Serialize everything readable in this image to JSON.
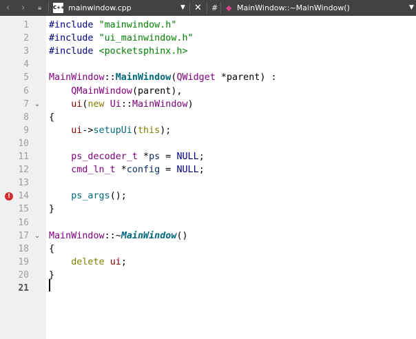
{
  "toolbar": {
    "back_icon": "chevron-left-icon",
    "forward_icon": "chevron-right-icon",
    "lock_icon": "lock-icon",
    "file_badge": "C++",
    "file_name": "mainwindow.cpp",
    "dropdown_icon": "caret-down-icon",
    "close_icon": "close-icon",
    "hash_label": "#",
    "symbol_icon": "method-icon",
    "symbol_name": "MainWindow::~MainWindow()",
    "symbol_dropdown_icon": "caret-down-icon"
  },
  "editor": {
    "current_line": "21",
    "error_line": "14",
    "lines": [
      {
        "num": "1",
        "tokens": [
          {
            "t": "#include ",
            "c": "pre"
          },
          {
            "t": "\"mainwindow.h\"",
            "c": "str"
          }
        ]
      },
      {
        "num": "2",
        "tokens": [
          {
            "t": "#include ",
            "c": "pre"
          },
          {
            "t": "\"ui_mainwindow.h\"",
            "c": "str"
          }
        ]
      },
      {
        "num": "3",
        "tokens": [
          {
            "t": "#include ",
            "c": "pre"
          },
          {
            "t": "<pocketsphinx.h>",
            "c": "str"
          }
        ]
      },
      {
        "num": "4",
        "tokens": []
      },
      {
        "num": "5",
        "tokens": [
          {
            "t": "MainWindow",
            "c": "type"
          },
          {
            "t": "::",
            "c": "plain"
          },
          {
            "t": "MainWindow",
            "c": "func"
          },
          {
            "t": "(",
            "c": "plain"
          },
          {
            "t": "QWidget",
            "c": "type"
          },
          {
            "t": " *",
            "c": "plain"
          },
          {
            "t": "parent",
            "c": "plain"
          },
          {
            "t": ") :",
            "c": "plain"
          }
        ]
      },
      {
        "num": "6",
        "tokens": [
          {
            "t": "    ",
            "c": "plain"
          },
          {
            "t": "QMainWindow",
            "c": "type"
          },
          {
            "t": "(",
            "c": "plain"
          },
          {
            "t": "parent",
            "c": "plain"
          },
          {
            "t": "),",
            "c": "plain"
          }
        ]
      },
      {
        "num": "7",
        "fold": true,
        "tokens": [
          {
            "t": "    ",
            "c": "plain"
          },
          {
            "t": "ui",
            "c": "member"
          },
          {
            "t": "(",
            "c": "plain"
          },
          {
            "t": "new ",
            "c": "kw"
          },
          {
            "t": "Ui",
            "c": "type"
          },
          {
            "t": "::",
            "c": "plain"
          },
          {
            "t": "MainWindow",
            "c": "type"
          },
          {
            "t": ")",
            "c": "plain"
          }
        ]
      },
      {
        "num": "8",
        "tokens": [
          {
            "t": "{",
            "c": "plain"
          }
        ]
      },
      {
        "num": "9",
        "tokens": [
          {
            "t": "    ",
            "c": "plain"
          },
          {
            "t": "ui",
            "c": "member"
          },
          {
            "t": "->",
            "c": "plain"
          },
          {
            "t": "setupUi",
            "c": "call"
          },
          {
            "t": "(",
            "c": "plain"
          },
          {
            "t": "this",
            "c": "kw"
          },
          {
            "t": ");",
            "c": "plain"
          }
        ]
      },
      {
        "num": "10",
        "tokens": []
      },
      {
        "num": "11",
        "tokens": [
          {
            "t": "    ",
            "c": "plain"
          },
          {
            "t": "ps_decoder_t",
            "c": "type"
          },
          {
            "t": " *",
            "c": "plain"
          },
          {
            "t": "ps",
            "c": "var"
          },
          {
            "t": " = ",
            "c": "plain"
          },
          {
            "t": "NULL",
            "c": "pre"
          },
          {
            "t": ";",
            "c": "plain"
          }
        ]
      },
      {
        "num": "12",
        "tokens": [
          {
            "t": "    ",
            "c": "plain"
          },
          {
            "t": "cmd_ln_t",
            "c": "type"
          },
          {
            "t": " *",
            "c": "plain"
          },
          {
            "t": "config",
            "c": "var"
          },
          {
            "t": " = ",
            "c": "plain"
          },
          {
            "t": "NULL",
            "c": "pre"
          },
          {
            "t": ";",
            "c": "plain"
          }
        ]
      },
      {
        "num": "13",
        "tokens": []
      },
      {
        "num": "14",
        "tokens": [
          {
            "t": "    ",
            "c": "plain"
          },
          {
            "t": "ps_args",
            "c": "call"
          },
          {
            "t": "();",
            "c": "plain"
          }
        ]
      },
      {
        "num": "15",
        "tokens": [
          {
            "t": "}",
            "c": "plain"
          }
        ]
      },
      {
        "num": "16",
        "tokens": []
      },
      {
        "num": "17",
        "fold": true,
        "tokens": [
          {
            "t": "MainWindow",
            "c": "type"
          },
          {
            "t": "::~",
            "c": "plain"
          },
          {
            "t": "MainWindow",
            "c": "ifunc"
          },
          {
            "t": "()",
            "c": "plain"
          }
        ]
      },
      {
        "num": "18",
        "tokens": [
          {
            "t": "{",
            "c": "plain"
          }
        ]
      },
      {
        "num": "19",
        "tokens": [
          {
            "t": "    ",
            "c": "plain"
          },
          {
            "t": "delete ",
            "c": "kw"
          },
          {
            "t": "ui",
            "c": "member"
          },
          {
            "t": ";",
            "c": "plain"
          }
        ]
      },
      {
        "num": "20",
        "tokens": [
          {
            "t": "}",
            "c": "plain"
          }
        ]
      },
      {
        "num": "21",
        "tokens": []
      }
    ]
  }
}
